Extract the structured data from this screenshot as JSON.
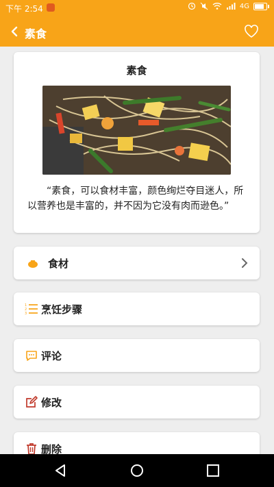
{
  "status_bar": {
    "time": "下午 2:54",
    "network": "4G"
  },
  "app_bar": {
    "title": "素食",
    "back_icon": "chevron-left-icon",
    "favorite_icon": "heart-icon"
  },
  "recipe": {
    "title": "素食",
    "image_subject": "vegetable-noodle-dish",
    "description": "“素食，可以食材丰富，颜色绚烂夺目迷人，所以营养也是丰富的，并不因为它没有肉而逊色。”"
  },
  "menu": [
    {
      "label": "食材",
      "icon": "ingredients-icon"
    },
    {
      "label": "烹饪步骤",
      "icon": "steps-list-icon"
    },
    {
      "label": "评论",
      "icon": "comment-icon"
    },
    {
      "label": "修改",
      "icon": "edit-icon"
    },
    {
      "label": "删除",
      "icon": "trash-icon"
    }
  ],
  "colors": {
    "accent": "#f8a418",
    "delete_icon": "#c0392b",
    "text": "#222222"
  }
}
